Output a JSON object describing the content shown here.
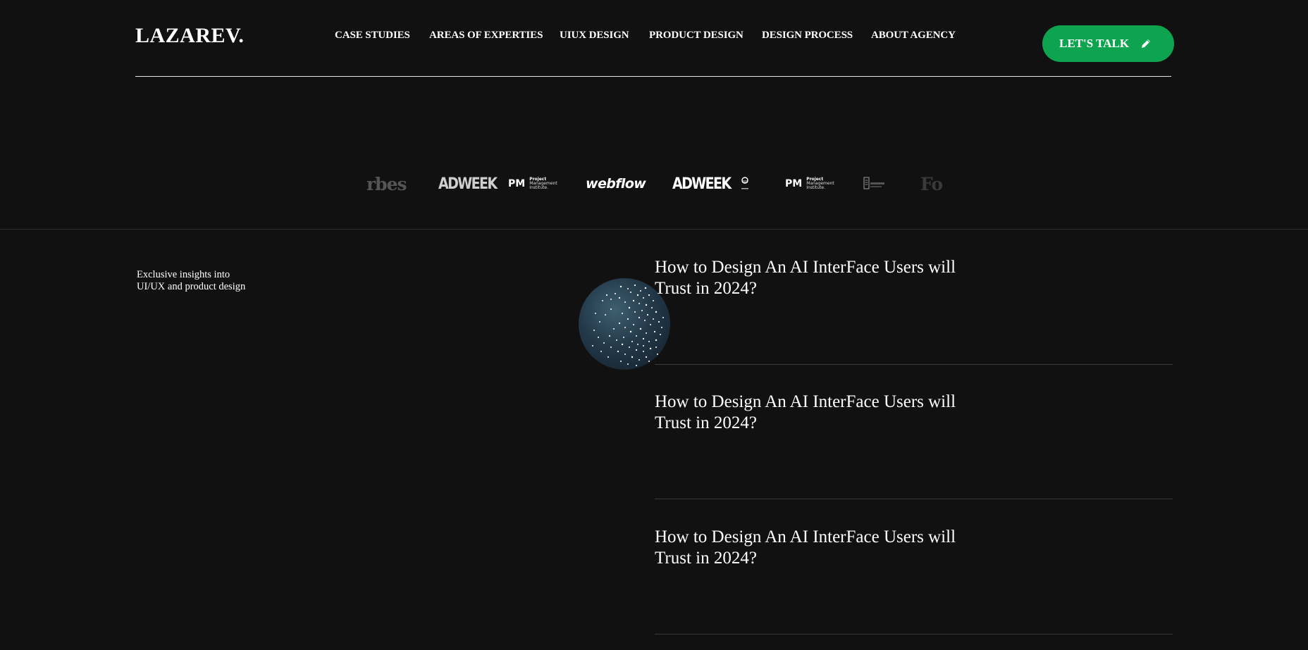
{
  "header": {
    "logo": "LAZAREV.",
    "nav": [
      {
        "label": "CASE STUDIES"
      },
      {
        "label": "AREAS OF EXPERTIES"
      },
      {
        "label": "UIUX DESIGN"
      },
      {
        "label": "PRODUCT DESIGN"
      },
      {
        "label": "DESIGN PROCESS"
      },
      {
        "label": "ABOUT AGENCY"
      }
    ],
    "cta_label": "LET'S TALK",
    "cta_icon": "pencil-icon",
    "accent_color": "#0ea44f"
  },
  "press_logos": {
    "forbes_partial_left": "rbes",
    "adweek_1": "ADWEEK",
    "pmi_1": {
      "mark": "PM",
      "line1": "Project",
      "line2": "Management",
      "line3": "Institute."
    },
    "webflow": "webflow",
    "adweek_2": "ADWEEK",
    "pmi_2": {
      "mark": "PM",
      "line1": "Project",
      "line2": "Management",
      "line3": "Institute."
    },
    "forbes_partial_right": "Fo"
  },
  "intro": {
    "tagline_line1": "Exclusive insights into",
    "tagline_line2": "UI/UX and product design"
  },
  "articles": [
    {
      "title": "How to Design An AI InterFace Users will Trust in 2024?"
    },
    {
      "title": "How to Design An AI InterFace Users will Trust in 2024?"
    },
    {
      "title": "How to Design An AI InterFace Users will Trust in 2024?"
    }
  ]
}
